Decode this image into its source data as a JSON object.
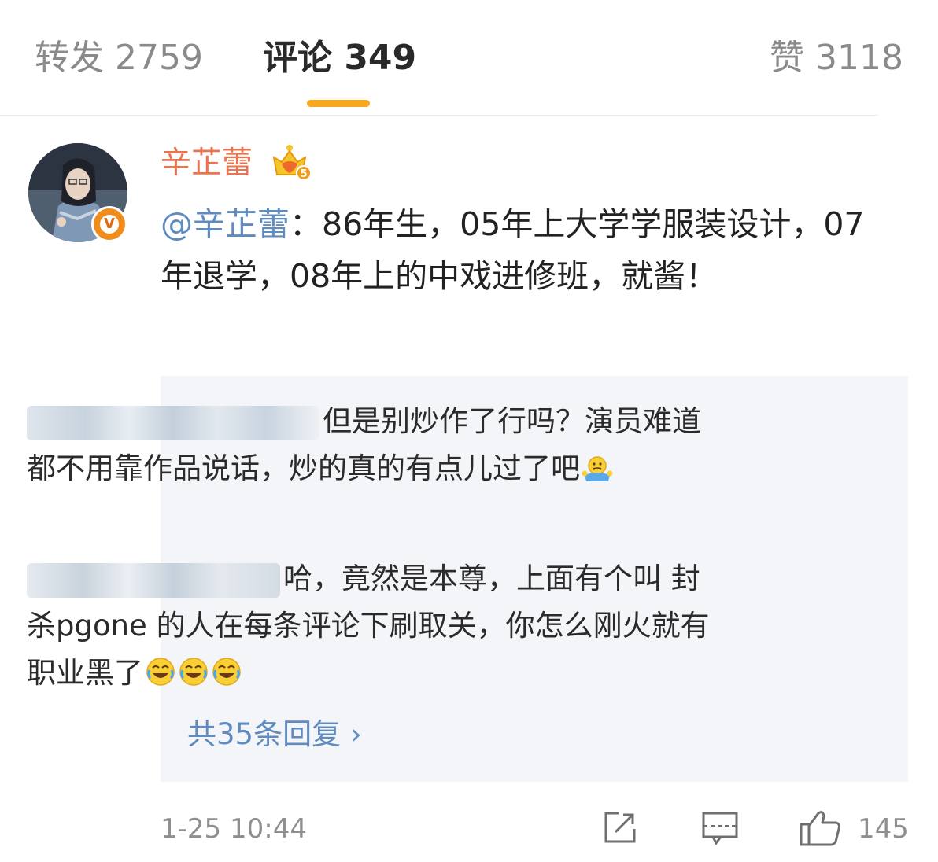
{
  "tabs": {
    "repost": "转发 2759",
    "comments": "评论 349",
    "likes": "赞 3118"
  },
  "comment": {
    "username": "辛芷蕾",
    "mention": "@辛芷蕾",
    "text": "：86年生，05年上大学学服装设计，07年退学，08年上的中戏进修班，就酱！",
    "time": "1-25 10:44",
    "like_count": "145"
  },
  "replies": {
    "items": [
      {
        "text": "但是别炒作了行吗？演员难道都不用靠作品说话，炒的真的有点儿过了吧"
      },
      {
        "text": "哈，竟然是本尊，上面有个叫 封杀pgone 的人在每条评论下刷取关，你怎么刚火就有职业黑了"
      }
    ],
    "more_label": "共35条回复 ›"
  },
  "icons": {
    "badge": "verified-v-icon",
    "crown": "crown-member-icon",
    "emoji_1": "shrug-emoji-icon",
    "emoji_2": "laugh-cry-emoji-icon",
    "share": "share-icon",
    "reply": "comment-icon",
    "like": "thumbs-up-icon"
  },
  "colors": {
    "accent": "#f7a81c",
    "username": "#eb7350",
    "link": "#5f8bc1",
    "reply_bg": "#f4f5f8"
  }
}
